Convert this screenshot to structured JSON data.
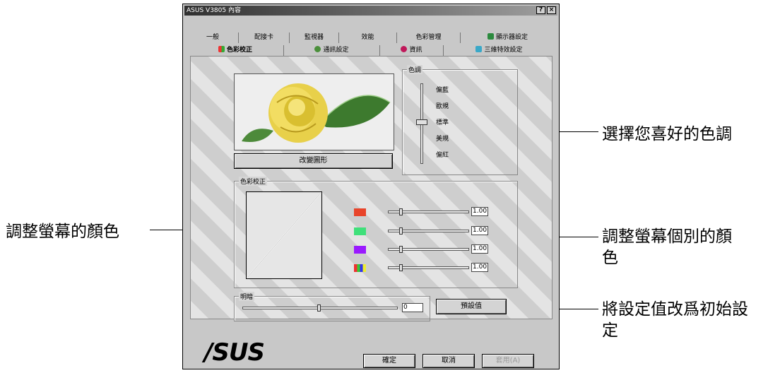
{
  "callouts": {
    "left": "調整螢幕的顏色",
    "right_top": "選擇您喜好的色調",
    "right_mid_line1": "調整螢幕個別的顏",
    "right_mid_line2": "色",
    "right_bottom_line1": "將設定值改爲初始設",
    "right_bottom_line2": "定"
  },
  "window": {
    "title": "ASUS V3805 內容",
    "help_btn": "?",
    "close_btn": "×"
  },
  "tabs_back": [
    "一般",
    "配接卡",
    "監視器",
    "效能",
    "色彩管理",
    "顯示器設定"
  ],
  "tabs_front": [
    "色彩校正",
    "通訊設定",
    "資訊",
    "三維特效設定"
  ],
  "tone": {
    "group_label": "色調",
    "levels": [
      "偏藍",
      "歐規",
      "標準",
      "美規",
      "偏紅"
    ],
    "selected": "標準"
  },
  "change_image_button": "改變圖形",
  "color_correction": {
    "group_label": "色彩校正",
    "channels": [
      {
        "name": "red",
        "color": "#e8442a",
        "value": "1.00"
      },
      {
        "name": "green",
        "color": "#3fe07a",
        "value": "1.00"
      },
      {
        "name": "blue",
        "color": "#9a1aff",
        "value": "1.00"
      },
      {
        "name": "all",
        "color": "multicolor",
        "value": "1.00"
      }
    ]
  },
  "brightness": {
    "group_label": "明暗",
    "value": "0"
  },
  "default_button": "預設值",
  "logo": "/SUS",
  "footer": {
    "ok": "確定",
    "cancel": "取消",
    "apply": "套用(A)"
  }
}
